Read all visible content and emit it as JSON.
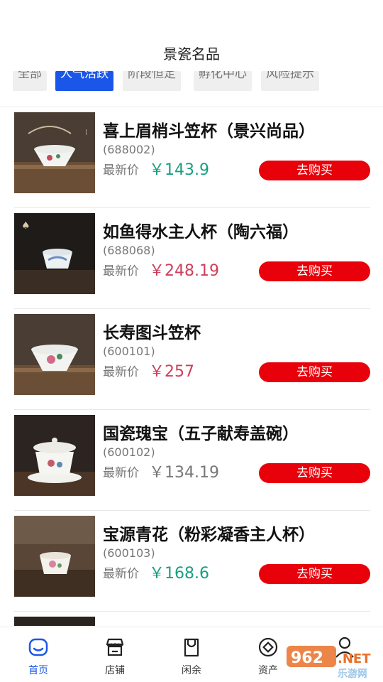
{
  "header": {
    "title": "景瓷名品"
  },
  "tabs": [
    {
      "label": "全部"
    },
    {
      "label": "人气活跃"
    },
    {
      "label": "阶段恒定"
    },
    {
      "label": "孵化中心"
    },
    {
      "label": "风险提示"
    }
  ],
  "products": [
    {
      "name": "喜上眉梢斗笠杯（景兴尚品）",
      "code": "(688002)",
      "price_label": "最新价",
      "price": "￥143.9",
      "price_color": "#1a9e82",
      "buy_label": "去购买"
    },
    {
      "name": "如鱼得水主人杯（陶六福）",
      "code": "(688068)",
      "price_label": "最新价",
      "price": "￥248.19",
      "price_color": "#cf3e5a",
      "buy_label": "去购买"
    },
    {
      "name": "长寿图斗笠杯",
      "code": "(600101)",
      "price_label": "最新价",
      "price": "￥257",
      "price_color": "#cf3e5a",
      "buy_label": "去购买"
    },
    {
      "name": "国瓷瑰宝（五子献寿盖碗）",
      "code": "(600102)",
      "price_label": "最新价",
      "price": "￥134.19",
      "price_color": "#777777",
      "buy_label": "去购买"
    },
    {
      "name": "宝源青花（粉彩凝香主人杯）",
      "code": "(600103)",
      "price_label": "最新价",
      "price": "￥168.6",
      "price_color": "#1a9e82",
      "buy_label": "去购买"
    }
  ],
  "tabbar": [
    {
      "label": "首页",
      "icon": "home-icon"
    },
    {
      "label": "店铺",
      "icon": "store-icon"
    },
    {
      "label": "闲余",
      "icon": "bag-icon"
    },
    {
      "label": "资产",
      "icon": "coin-icon"
    },
    {
      "label": "",
      "icon": "profile-icon"
    }
  ],
  "watermark": {
    "text": "962.NET",
    "sub": "乐游网"
  },
  "colors": {
    "accent": "#1a56e8",
    "buy": "#e8000b"
  }
}
